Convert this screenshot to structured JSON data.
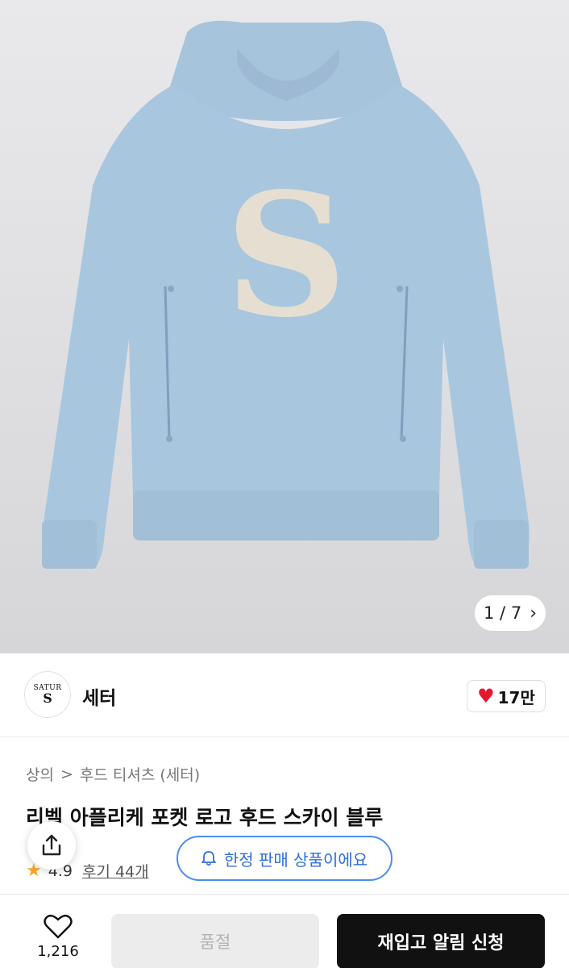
{
  "gallery": {
    "current": "1",
    "separator": "/",
    "total": "7",
    "next_icon": "chevron-right-icon",
    "image_description_colors": {
      "hoodie": "#a9c6df",
      "logo_patch": "#e6dfd1"
    }
  },
  "seller": {
    "logo_text": "SATUR",
    "logo_mark": "S",
    "name": "세터",
    "like_count": "17만",
    "like_icon": "heart-filled-icon",
    "like_color": "#e5172f"
  },
  "product": {
    "breadcrumb": [
      "상의",
      "후드 티셔츠 (세터)"
    ],
    "breadcrumb_sep": ">",
    "title": "리벨 아플리케 포켓 로고 후드 스카이 블루",
    "rating": "4.9",
    "review_label": "후기 44개",
    "limited_label": "한정 판매 상품이에요",
    "accent_color": "#4a8df0"
  },
  "bottom": {
    "wish_count": "1,216",
    "soldout_label": "품절",
    "restock_label": "재입고 알림 신청"
  }
}
